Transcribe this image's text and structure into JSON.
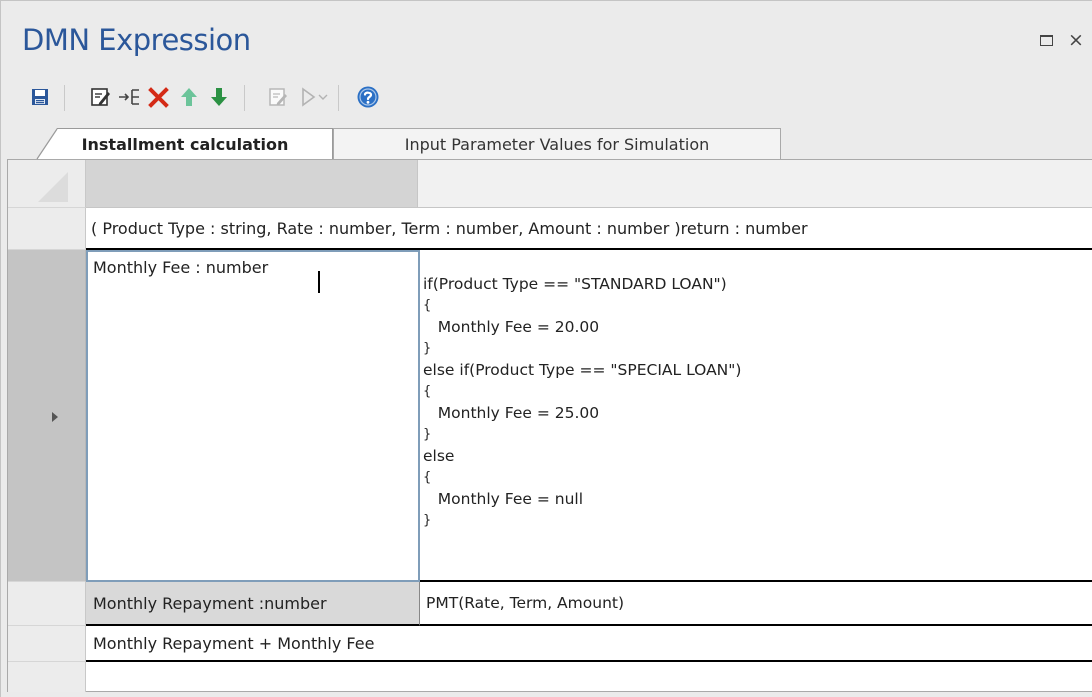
{
  "window": {
    "title": "DMN Expression",
    "maximize_glyph": "□",
    "close_glyph": "×"
  },
  "toolbar": {
    "buttons": [
      {
        "name": "save-icon"
      },
      {
        "name": "edit-icon"
      },
      {
        "name": "insert-row-icon"
      },
      {
        "name": "delete-icon",
        "color": "#d42a16"
      },
      {
        "name": "move-up-icon",
        "color": "#6cc49a"
      },
      {
        "name": "move-down-icon",
        "color": "#2b9143"
      },
      {
        "name": "validate-icon"
      },
      {
        "name": "run-simulation-icon"
      },
      {
        "name": "dropdown-arrow-icon"
      },
      {
        "name": "help-icon",
        "color": "#2b70c5"
      }
    ]
  },
  "tabs": [
    {
      "label": "Installment calculation",
      "active": true
    },
    {
      "label": "Input Parameter Values for Simulation",
      "active": false
    }
  ],
  "grid": {
    "signature": "( Product Type : string, Rate : number, Term : number, Amount : number )return : number",
    "rows": [
      {
        "name": "Monthly Fee : number",
        "expression_lines": [
          "if(Product Type == \"STANDARD LOAN\")",
          "{",
          "   Monthly Fee = 20.00",
          "}",
          "else if(Product Type == \"SPECIAL LOAN\")",
          "{",
          "   Monthly Fee = 25.00",
          "}",
          "else",
          "{",
          "   Monthly Fee = null",
          "}"
        ]
      },
      {
        "name": "Monthly Repayment :number",
        "expression": "PMT(Rate, Term, Amount)"
      }
    ],
    "result_expression": "Monthly Repayment + Monthly Fee"
  },
  "colors": {
    "title": "#2b579a",
    "selected_row_header": "#c4c4c4",
    "selected_cell_border": "#7f9db9"
  }
}
